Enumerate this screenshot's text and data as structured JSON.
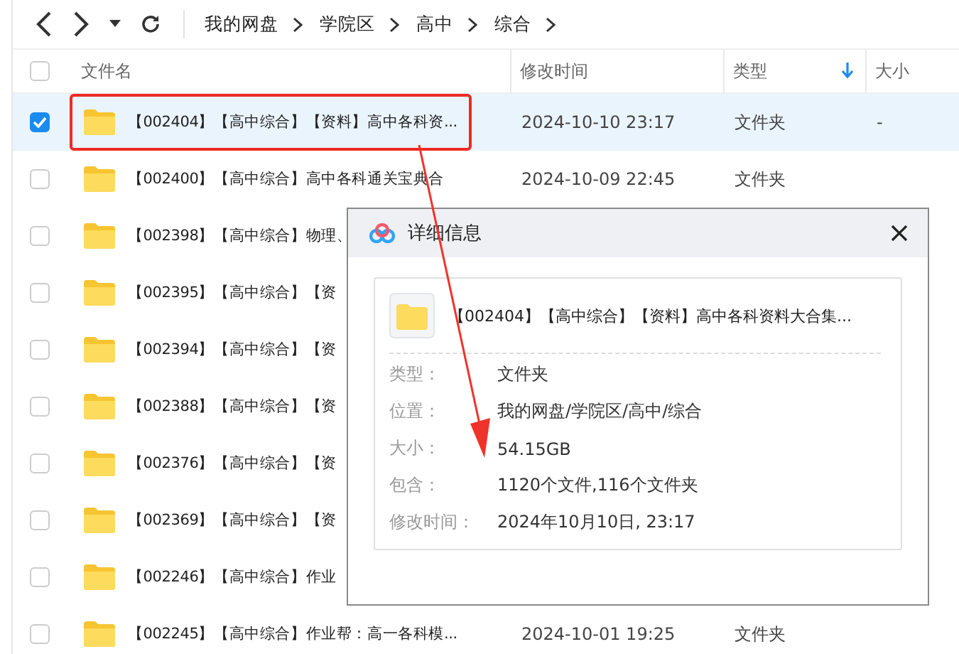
{
  "toolbar": {
    "breadcrumb": [
      "我的网盘",
      "学院区",
      "高中",
      "综合"
    ]
  },
  "table": {
    "all_checked": false,
    "columns": [
      {
        "label": "文件名",
        "sorted": false
      },
      {
        "label": "修改时间",
        "sorted": false
      },
      {
        "label": "类型",
        "sorted": true
      },
      {
        "label": "大小",
        "sorted": false
      }
    ],
    "rows": [
      {
        "checked": true,
        "selected": true,
        "annotated": true,
        "name": "【002404】【高中综合】【资料】高中各科资...",
        "modified": "2024-10-10 23:17",
        "type": "文件夹",
        "size": "-"
      },
      {
        "checked": false,
        "selected": false,
        "annotated": false,
        "name": "【002400】【高中综合】高中各科通关宝典合",
        "modified": "2024-10-09 22:45",
        "type": "文件夹"
      },
      {
        "checked": false,
        "selected": false,
        "annotated": false,
        "name": "【002398】【高中综合】物理、"
      },
      {
        "checked": false,
        "selected": false,
        "annotated": false,
        "name": "【002395】【高中综合】【资"
      },
      {
        "checked": false,
        "selected": false,
        "annotated": false,
        "name": "【002394】【高中综合】【资"
      },
      {
        "checked": false,
        "selected": false,
        "annotated": false,
        "name": "【002388】【高中综合】【资"
      },
      {
        "checked": false,
        "selected": false,
        "annotated": false,
        "name": "【002376】【高中综合】【资"
      },
      {
        "checked": false,
        "selected": false,
        "annotated": false,
        "name": "【002369】【高中综合】【资"
      },
      {
        "checked": false,
        "selected": false,
        "annotated": false,
        "name": "【002246】【高中综合】作业"
      },
      {
        "checked": false,
        "selected": false,
        "annotated": false,
        "name": "【002245】【高中综合】作业帮：高一各科模...",
        "modified": "2024-10-01 19:25",
        "type": "文件夹"
      }
    ]
  },
  "dialog": {
    "title": "详细信息",
    "name": "【002404】【高中综合】【资料】高中各科资料大合集...",
    "details": [
      {
        "label": "类型：",
        "value": "文件夹"
      },
      {
        "label": "位置：",
        "value": "我的网盘/学院区/高中/综合"
      },
      {
        "label": "大小：",
        "value": "54.15GB"
      },
      {
        "label": "包含：",
        "value": "1120个文件,116个文件夹"
      },
      {
        "label": "修改时间：",
        "value": "2024年10月10日, 23:17"
      }
    ]
  }
}
